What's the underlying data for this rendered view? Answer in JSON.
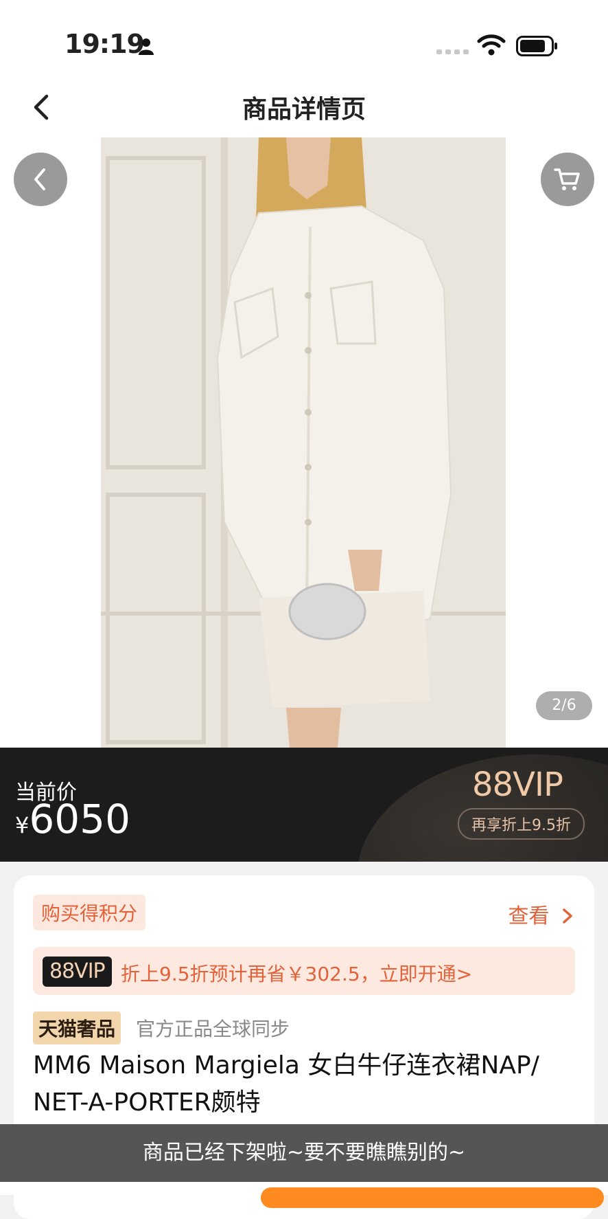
{
  "status_bar": {
    "time": "19:19"
  },
  "nav": {
    "title": "商品详情页"
  },
  "gallery": {
    "counter": "2/6"
  },
  "price": {
    "label": "当前价",
    "currency": "¥",
    "amount": "6050",
    "vip_logo": "88VIP",
    "vip_badge": "再享折上9.5折"
  },
  "card": {
    "points_tag": "购买得积分",
    "view_link": "查看",
    "vip_chip": "88VIP",
    "vip_promo": "折上9.5折预计再省￥302.5，立即开通>",
    "tmall_tag": "天猫奢品",
    "official_text": "官方正品全球同步",
    "product_title": "MM6 Maison Margiela 女白牛仔连衣裙NAP/ NET-A-PORTER颇特"
  },
  "toast": {
    "message": "商品已经下架啦~要不要瞧瞧别的~"
  },
  "colors": {
    "accent": "#e2623a",
    "price_bar": "#1c1c1c",
    "vip_gold": "#f0c9a8",
    "tmall_gold": "#f2d5aa"
  }
}
